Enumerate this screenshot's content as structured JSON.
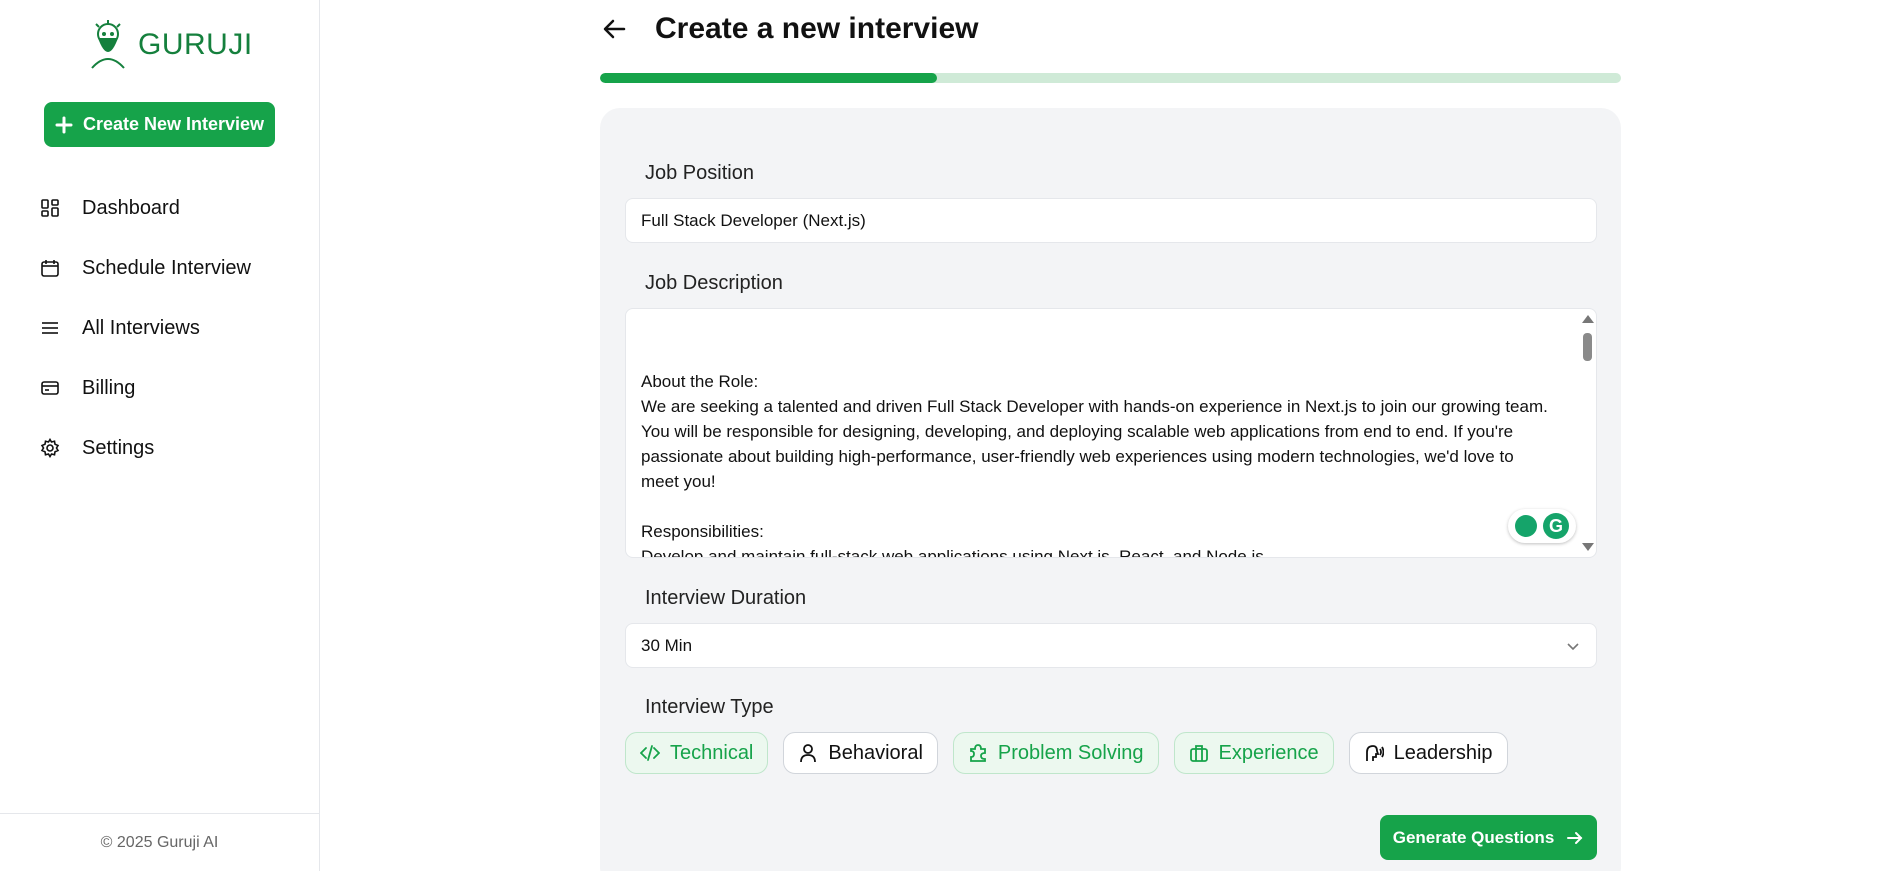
{
  "brand": {
    "name": "GURUJI"
  },
  "sidebar": {
    "create_label": "Create New Interview",
    "items": [
      {
        "label": "Dashboard",
        "icon": "dashboard-icon"
      },
      {
        "label": "Schedule Interview",
        "icon": "calendar-icon"
      },
      {
        "label": "All Interviews",
        "icon": "list-icon"
      },
      {
        "label": "Billing",
        "icon": "credit-card-icon"
      },
      {
        "label": "Settings",
        "icon": "gear-icon"
      }
    ],
    "footer": "© 2025 Guruji AI"
  },
  "header": {
    "title": "Create a new interview"
  },
  "progress": {
    "fraction": 0.33
  },
  "form": {
    "job_position_label": "Job Position",
    "job_position_value": "Full Stack Developer (Next.js)",
    "job_description_label": "Job Description",
    "job_description_value": "About the Role:\nWe are seeking a talented and driven Full Stack Developer with hands-on experience in Next.js to join our growing team. You will be responsible for designing, developing, and deploying scalable web applications from end to end. If you're passionate about building high-performance, user-friendly web experiences using modern technologies, we'd love to meet you!\n\nResponsibilities:\nDevelop and maintain full-stack web applications using Next.js, React, and Node.js.\n\nDesign and implement RESTful APIs or GraphQL endpoints.",
    "duration_label": "Interview Duration",
    "duration_value": "30 Min",
    "type_label": "Interview Type",
    "types": [
      {
        "label": "Technical",
        "selected": true,
        "icon": "code-icon"
      },
      {
        "label": "Behavioral",
        "selected": false,
        "icon": "user-icon"
      },
      {
        "label": "Problem Solving",
        "selected": true,
        "icon": "puzzle-icon"
      },
      {
        "label": "Experience",
        "selected": true,
        "icon": "briefcase-icon"
      },
      {
        "label": "Leadership",
        "selected": false,
        "icon": "speaking-head-icon"
      }
    ],
    "generate_label": "Generate Questions"
  },
  "colors": {
    "accent": "#16a34a",
    "accent_light": "#cfead7"
  }
}
